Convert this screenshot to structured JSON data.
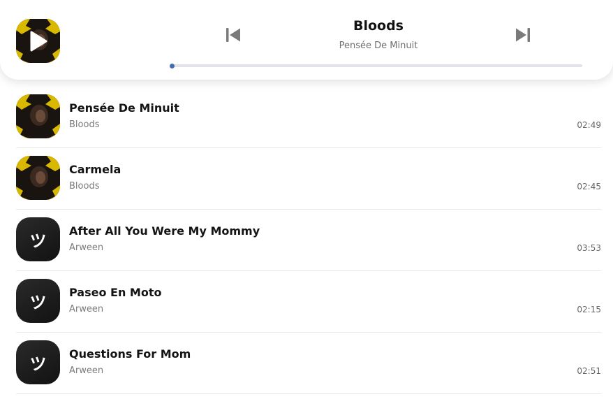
{
  "player": {
    "title": "Bloods",
    "artist": "Pensée De Minuit",
    "progress": 0.0,
    "accent_color": "#3e6fb5",
    "play_icon": "play-icon",
    "prev_icon": "skip-previous-icon",
    "next_icon": "skip-next-icon"
  },
  "tracks": [
    {
      "title": "Pensée De Minuit",
      "artist": "Bloods",
      "duration": "02:49",
      "art": "album-cover"
    },
    {
      "title": "Carmela",
      "artist": "Bloods",
      "duration": "02:45",
      "art": "album-cover"
    },
    {
      "title": "After All You Were My Mommy",
      "artist": "Arween",
      "duration": "03:53",
      "art": "placeholder",
      "art_glyph": "ツ"
    },
    {
      "title": "Paseo En Moto",
      "artist": "Arween",
      "duration": "02:15",
      "art": "placeholder",
      "art_glyph": "ツ"
    },
    {
      "title": "Questions For Mom",
      "artist": "Arween",
      "duration": "02:51",
      "art": "placeholder",
      "art_glyph": "ツ"
    }
  ]
}
